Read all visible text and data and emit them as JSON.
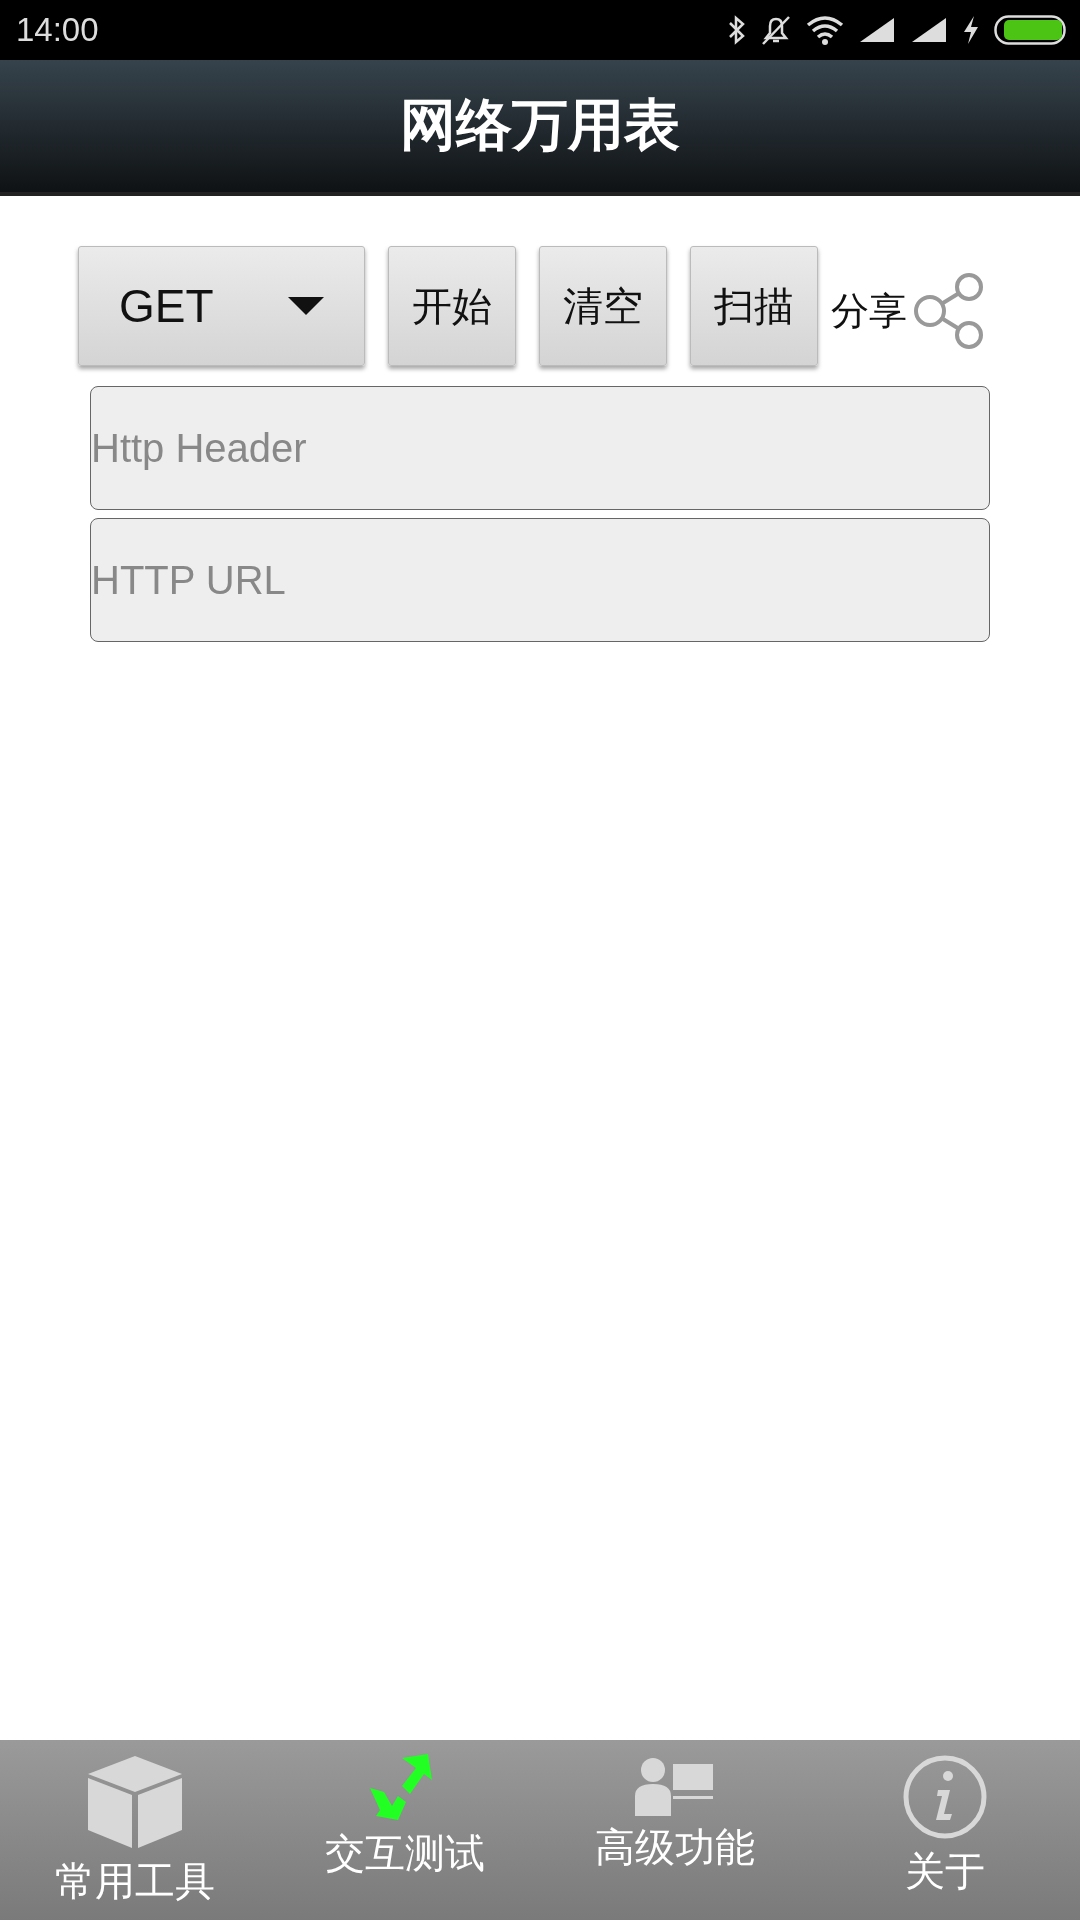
{
  "status_bar": {
    "time": "14:00"
  },
  "title": "网络万用表",
  "toolbar": {
    "method": "GET",
    "buttons": [
      "开始",
      "清空",
      "扫描"
    ],
    "share": "分享"
  },
  "fields": [
    {
      "placeholder": "Http Header"
    },
    {
      "placeholder": "HTTP URL"
    }
  ],
  "tabs": [
    {
      "label": "常用工具",
      "kind": "box",
      "selected": false
    },
    {
      "label": "交互测试",
      "kind": "arrows",
      "selected": true
    },
    {
      "label": "高级功能",
      "kind": "person",
      "selected": false
    },
    {
      "label": "关于",
      "kind": "info",
      "selected": false
    }
  ]
}
